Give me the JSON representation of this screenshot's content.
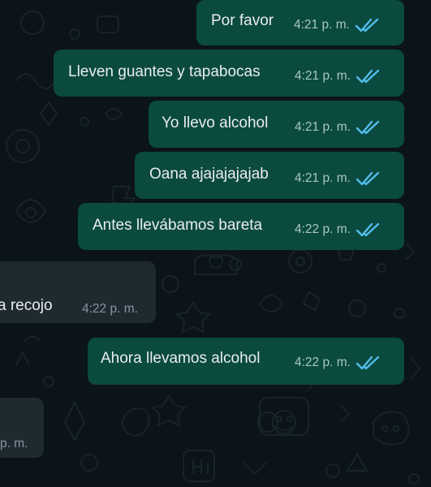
{
  "colors": {
    "background": "#0b141a",
    "outgoing_bubble": "#0b4a3f",
    "incoming_bubble": "#1f2a30",
    "read_ticks": "#53bdeb",
    "text": "#e9edef"
  },
  "messages": [
    {
      "direction": "outgoing",
      "text": "Por favor",
      "time": "4:21 p. m.",
      "status": "read"
    },
    {
      "direction": "outgoing",
      "text": "Lleven guantes y tapabocas",
      "time": "4:21 p. m.",
      "status": "read"
    },
    {
      "direction": "outgoing",
      "text": "Yo llevo alcohol",
      "time": "4:21 p. m.",
      "status": "read"
    },
    {
      "direction": "outgoing",
      "text": "Oana ajajajajajab",
      "time": "4:21 p. m.",
      "status": "read"
    },
    {
      "direction": "outgoing",
      "text": "Antes llevábamos bareta",
      "time": "4:22 p. m.",
      "status": "read"
    },
    {
      "direction": "incoming",
      "text": "a recojo",
      "time": "4:22 p. m."
    },
    {
      "direction": "outgoing",
      "text": "Ahora llevamos alcohol",
      "time": "4:22 p. m.",
      "status": "read"
    },
    {
      "direction": "incoming",
      "text": "",
      "time": "p. m."
    }
  ]
}
